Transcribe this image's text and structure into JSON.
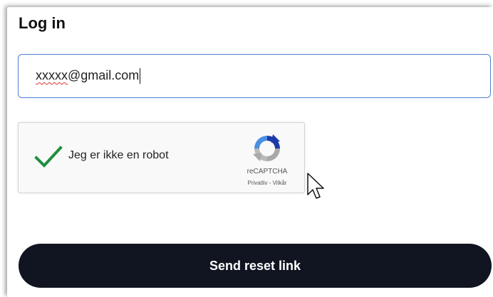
{
  "form": {
    "title": "Log in",
    "email_value_flagged": "xxxxx",
    "email_value_rest": "@gmail.com",
    "submit_label": "Send reset link"
  },
  "recaptcha": {
    "label": "Jeg er ikke en robot",
    "brand": "reCAPTCHA",
    "links": "Privatliv - Vilkår",
    "checked": true,
    "check_color": "#1e8e3e",
    "icons": [
      "check-icon",
      "recaptcha-logo-icon"
    ]
  },
  "colors": {
    "input_border": "#4a7fd6",
    "button_bg": "#111421",
    "button_text": "#ffffff"
  },
  "icons": {
    "pointer": "mouse-pointer-icon"
  }
}
